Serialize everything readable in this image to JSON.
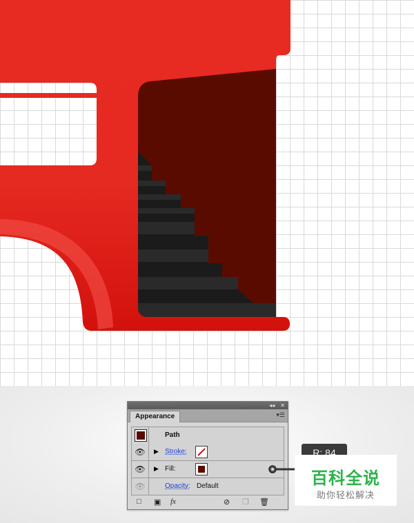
{
  "colors": {
    "red_main": "#e52a22",
    "red_dark": "#5a0b00",
    "stairs_dark": "#1b1b1b",
    "stairs_mid": "#2a2a2a"
  },
  "panel": {
    "tab_label": "Appearance",
    "titlebar_icons": [
      "collapse-icon",
      "close-icon"
    ],
    "menu_icon": "panel-menu-icon",
    "path_label": "Path",
    "stroke_label": "Stroke:",
    "fill_label": "Fill:",
    "opacity_label": "Opacity:",
    "opacity_value": "Default",
    "fx_label": "fx"
  },
  "callout": {
    "badge_text": "R: 84"
  },
  "watermark": {
    "title": "百科全说",
    "subtitle": "助你轻松解决"
  }
}
